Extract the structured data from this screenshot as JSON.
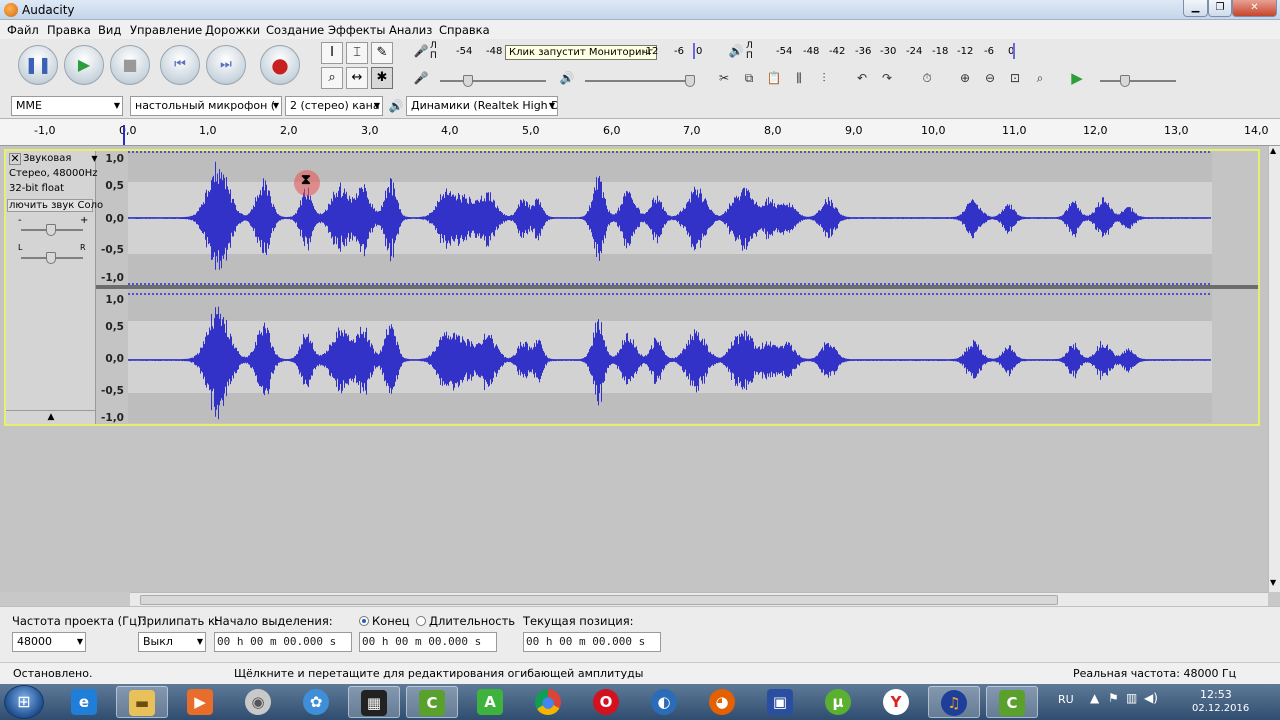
{
  "window": {
    "title": "Audacity"
  },
  "menu": [
    "Файл",
    "Правка",
    "Вид",
    "Управление",
    "Дорожки",
    "Создание",
    "Эффекты",
    "Анализ",
    "Справка"
  ],
  "transport": {
    "pause": "pause-icon",
    "play": "play-icon",
    "stop": "stop-icon",
    "skip_start": "skip-start-icon",
    "skip_end": "skip-end-icon",
    "record": "record-icon"
  },
  "meters": {
    "record_lr": "Л\nП",
    "record_scale": [
      "-54",
      "-48"
    ],
    "record_scale_tail": [
      "-12",
      "-6",
      "0"
    ],
    "tooltip": "Клик запустит Мониторинг",
    "play_lr": "Л\nП",
    "play_scale": [
      "-54",
      "-48",
      "-42",
      "-36",
      "-30",
      "-24",
      "-18",
      "-12",
      "-6",
      "0"
    ]
  },
  "device_toolbar": {
    "host": "MME",
    "input_device": "настольный микрофон (",
    "channels": "2 (стерео) кана",
    "output_device": "Динамики (Realtek High D"
  },
  "ruler": {
    "labels": [
      "-1,0",
      "0,0",
      "1,0",
      "2,0",
      "3,0",
      "4,0",
      "5,0",
      "6,0",
      "7,0",
      "8,0",
      "9,0",
      "10,0",
      "11,0",
      "12,0",
      "13,0",
      "14,0"
    ]
  },
  "track": {
    "name": "Звуковая",
    "info_line1": "Стерео, 48000Hz",
    "info_line2": "32-bit float",
    "mute_solo": "лючить звук Соло",
    "gain_minus": "-",
    "gain_plus": "+",
    "pan_left": "L",
    "pan_right": "R",
    "scale_top": [
      "1,0",
      "0,5",
      "0,0",
      "-0,5",
      "-1,0"
    ],
    "scale_bottom": [
      "1,0",
      "0,5",
      "0,0",
      "-0,5",
      "-1,0"
    ],
    "waveform_color": "#3232c8"
  },
  "selection_bar": {
    "project_rate_label": "Частота проекта (Гц):",
    "project_rate": "48000",
    "snap_label": "Прилипать к:",
    "snap_value": "Выкл",
    "sel_start_label": "Начало выделения:",
    "sel_start": "00 h 00 m 00.000 s",
    "end_label": "Конец",
    "length_label": "Длительность",
    "sel_end": "00 h 00 m 00.000 s",
    "position_label": "Текущая позиция:",
    "position": "00 h 00 m 00.000 s"
  },
  "status": {
    "left": "Остановлено.",
    "middle": "Щёлкните и перетащите для редактирования огибающей амплитуды",
    "right": "Реальная частота: 48000 Гц"
  },
  "taskbar": {
    "items": [
      "ie-icon",
      "explorer-icon",
      "media-player-icon",
      "cd-icon",
      "paint-icon",
      "video-editor-icon",
      "camtasia-icon",
      "a-app-icon",
      "chrome-icon",
      "opera-icon",
      "app-icon",
      "firefox-icon",
      "save-icon",
      "utorrent-icon",
      "yandex-icon",
      "audacity-icon",
      "camtasia-recorder-icon"
    ],
    "lang": "RU",
    "time": "12:53",
    "date": "02.12.2016"
  }
}
